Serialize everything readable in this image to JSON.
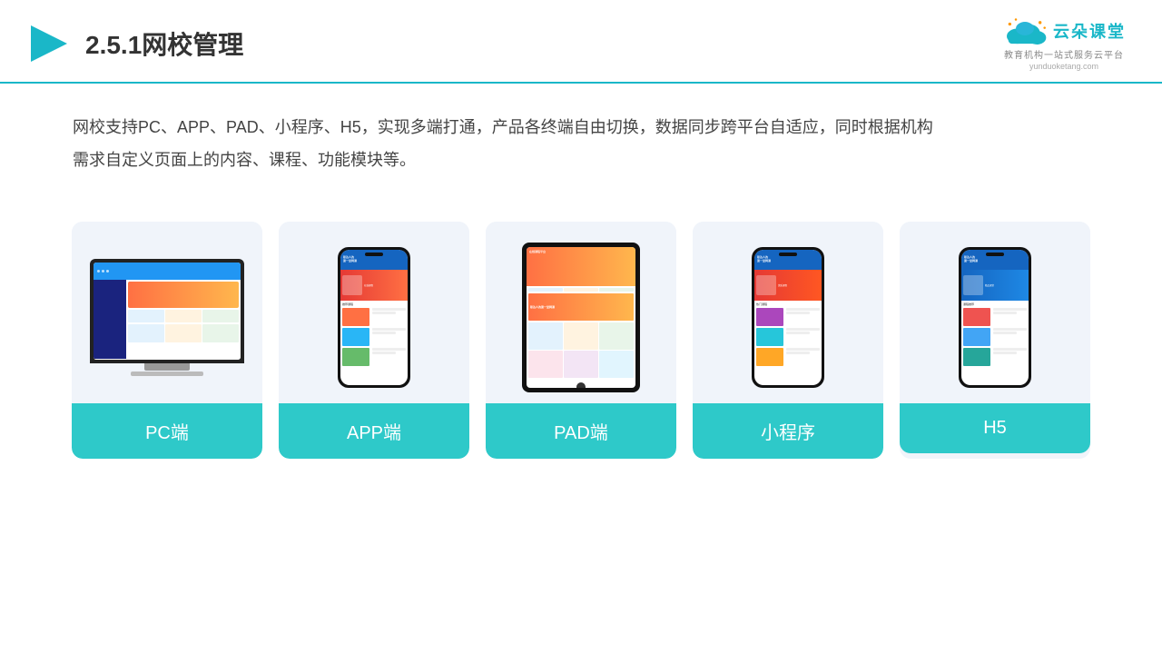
{
  "header": {
    "title_prefix": "2.5.1",
    "title_main": "网校管理",
    "logo_text": "云朵课堂",
    "logo_sub": "教育机构一站\n式服务云平台",
    "logo_url": "yunduoketang.com"
  },
  "description": {
    "text": "网校支持PC、APP、PAD、小程序、H5，实现多端打通，产品各终端自由切换，数据同步跨平台自适应，同时根据机构需求自定义页面上的内容、课程、功能模块等。"
  },
  "cards": [
    {
      "id": "pc",
      "label": "PC端",
      "type": "pc"
    },
    {
      "id": "app",
      "label": "APP端",
      "type": "phone"
    },
    {
      "id": "pad",
      "label": "PAD端",
      "type": "pad"
    },
    {
      "id": "miniapp",
      "label": "小程序",
      "type": "phone"
    },
    {
      "id": "h5",
      "label": "H5",
      "type": "phone"
    }
  ],
  "colors": {
    "accent": "#2ec9c9",
    "header_line": "#1ab7c8",
    "card_bg": "#f0f4fa",
    "text_primary": "#333",
    "text_secondary": "#444"
  }
}
